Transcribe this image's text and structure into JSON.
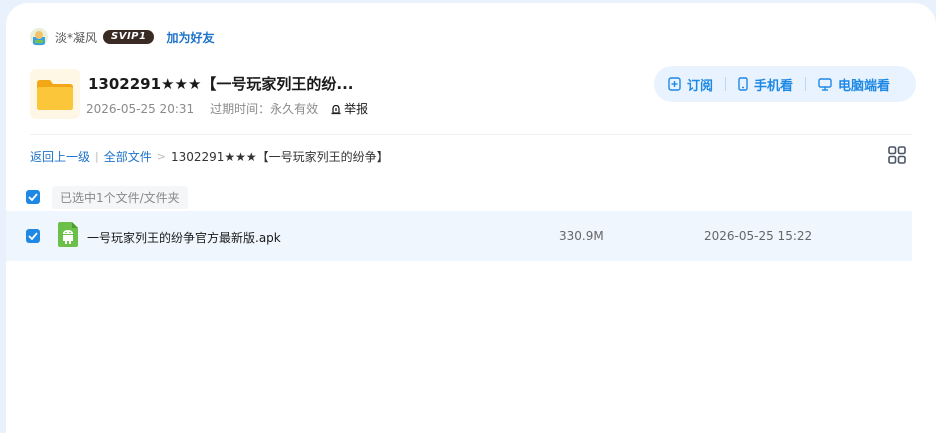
{
  "sharer": {
    "name": "淡*凝风",
    "vip_badge": "SVIP1",
    "add_friend": "加为好友"
  },
  "share": {
    "title": "1302291★★★【一号玩家列王的纷...",
    "created": "2026-05-25 20:31",
    "expire_label": "过期时间：",
    "expire_value": "永久有效",
    "report": "举报"
  },
  "actions": {
    "subscribe": "订阅",
    "mobile": "手机看",
    "pc": "电脑端看"
  },
  "breadcrumb": {
    "back": "返回上一级",
    "all_files": "全部文件",
    "current": "1302291★★★【一号玩家列王的纷争】"
  },
  "selection": {
    "label": "已选中1个文件/文件夹",
    "checked": true
  },
  "files": [
    {
      "name": "一号玩家列王的纷争官方最新版.apk",
      "size": "330.9M",
      "date": "2026-05-25 15:22",
      "checked": true,
      "icon": "android-apk-icon"
    }
  ],
  "colors": {
    "accent": "#1e88e5",
    "link": "#1e73c8",
    "page_bg": "#e9f2fc",
    "row_selected": "#eff6fd",
    "action_bar": "#e8f3ff",
    "folder": "#f7b92b",
    "apk": "#6cc04a"
  }
}
